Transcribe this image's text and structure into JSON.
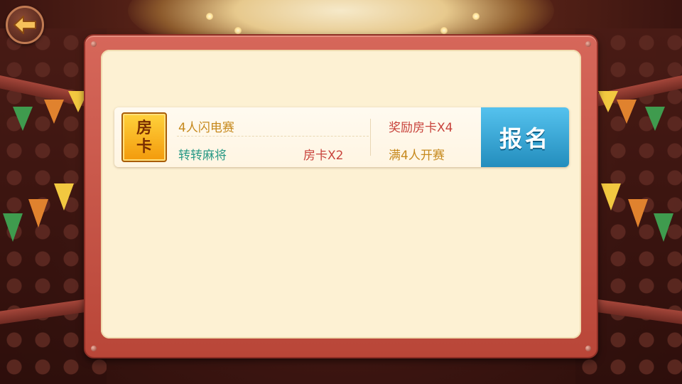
{
  "icons": {
    "back": "back-arrow-icon",
    "room_card": "room-card-badge"
  },
  "colors": {
    "panel_frame": "#c8544a",
    "panel_inner": "#fdf1d3",
    "signup_button": "#3aa8d6",
    "card_badge": "#f6b21a",
    "text_gold": "#c6891d",
    "text_teal": "#2a9a86",
    "text_red": "#c8433c"
  },
  "match": {
    "badge_line1": "房",
    "badge_line2": "卡",
    "name": "4人闪电赛",
    "game": "转转麻将",
    "cost": "房卡X2",
    "reward": "奖励房卡X4",
    "start_condition": "满4人开赛",
    "signup_label": "报名"
  }
}
